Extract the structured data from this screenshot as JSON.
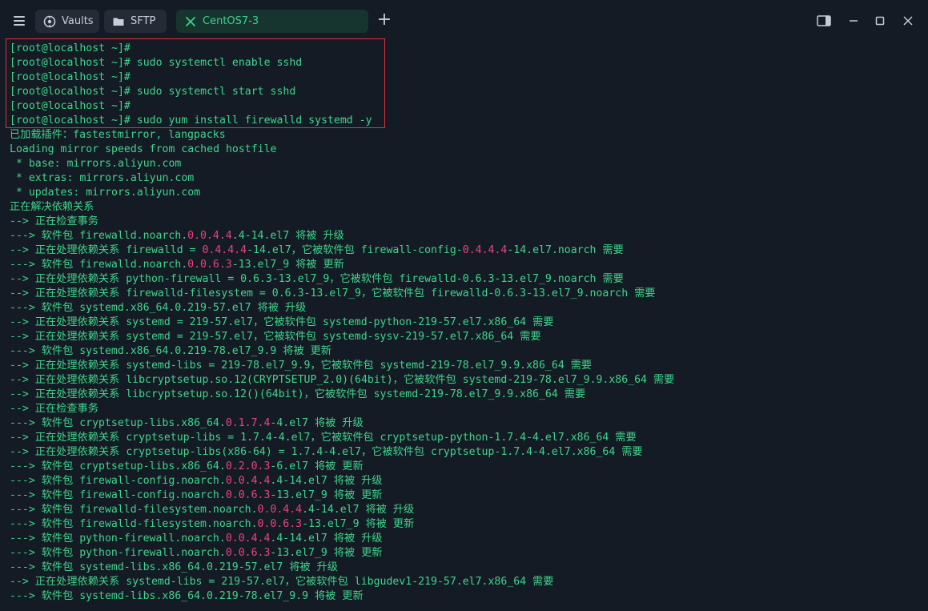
{
  "tabs": [
    {
      "label": "Vaults",
      "icon": "vault-icon"
    },
    {
      "label": "SFTP",
      "icon": "folder-icon"
    },
    {
      "label": "CentOS7-3",
      "icon": "close-icon",
      "active": true
    }
  ],
  "colors": {
    "accent": "#3fcf8e",
    "highlight_border": "#e0303e",
    "version_highlight": "#e8457f",
    "terminal_text": "#3ed58b"
  },
  "terminal": {
    "lines": [
      {
        "segments": [
          "[root@localhost ~]#"
        ]
      },
      {
        "segments": [
          "[root@localhost ~]# sudo systemctl enable sshd"
        ]
      },
      {
        "segments": [
          "[root@localhost ~]#"
        ]
      },
      {
        "segments": [
          "[root@localhost ~]# sudo systemctl start sshd"
        ]
      },
      {
        "segments": [
          "[root@localhost ~]#"
        ]
      },
      {
        "segments": [
          "[root@localhost ~]# sudo yum install firewalld systemd -y"
        ]
      },
      {
        "segments": [
          "已加载插件：fastestmirror, langpacks"
        ]
      },
      {
        "segments": [
          "Loading mirror speeds from cached hostfile"
        ]
      },
      {
        "segments": [
          " * base: mirrors.aliyun.com"
        ]
      },
      {
        "segments": [
          " * extras: mirrors.aliyun.com"
        ]
      },
      {
        "segments": [
          " * updates: mirrors.aliyun.com"
        ]
      },
      {
        "segments": [
          "正在解决依赖关系"
        ]
      },
      {
        "segments": [
          "--> 正在检查事务"
        ]
      },
      {
        "segments": [
          "---> 软件包 firewalld.noarch.",
          "0.0.4.4",
          ".4-14.el7 将被 升级"
        ]
      },
      {
        "segments": [
          "--> 正在处理依赖关系 firewalld = ",
          "0.4.4.4",
          "-14.el7，它被软件包 firewall-config-",
          "0.4.4.4",
          "-14.el7.noarch 需要"
        ]
      },
      {
        "segments": [
          "---> 软件包 firewalld.noarch.",
          "0.0.6.3",
          "-13.el7_9 将被 更新"
        ]
      },
      {
        "segments": [
          "--> 正在处理依赖关系 python-firewall = 0.6.3-13.el7_9，它被软件包 firewalld-0.6.3-13.el7_9.noarch 需要"
        ]
      },
      {
        "segments": [
          "--> 正在处理依赖关系 firewalld-filesystem = 0.6.3-13.el7_9，它被软件包 firewalld-0.6.3-13.el7_9.noarch 需要"
        ]
      },
      {
        "segments": [
          "---> 软件包 systemd.x86_64.0.219-57.el7 将被 升级"
        ]
      },
      {
        "segments": [
          "--> 正在处理依赖关系 systemd = 219-57.el7，它被软件包 systemd-python-219-57.el7.x86_64 需要"
        ]
      },
      {
        "segments": [
          "--> 正在处理依赖关系 systemd = 219-57.el7，它被软件包 systemd-sysv-219-57.el7.x86_64 需要"
        ]
      },
      {
        "segments": [
          "---> 软件包 systemd.x86_64.0.219-78.el7_9.9 将被 更新"
        ]
      },
      {
        "segments": [
          "--> 正在处理依赖关系 systemd-libs = 219-78.el7_9.9，它被软件包 systemd-219-78.el7_9.9.x86_64 需要"
        ]
      },
      {
        "segments": [
          "--> 正在处理依赖关系 libcryptsetup.so.12(CRYPTSETUP_2.0)(64bit)，它被软件包 systemd-219-78.el7_9.9.x86_64 需要"
        ]
      },
      {
        "segments": [
          "--> 正在处理依赖关系 libcryptsetup.so.12()(64bit)，它被软件包 systemd-219-78.el7_9.9.x86_64 需要"
        ]
      },
      {
        "segments": [
          "--> 正在检查事务"
        ]
      },
      {
        "segments": [
          "---> 软件包 cryptsetup-libs.x86_64.",
          "0.1.7.4",
          "-4.el7 将被 升级"
        ]
      },
      {
        "segments": [
          "--> 正在处理依赖关系 cryptsetup-libs = 1.7.4-4.el7，它被软件包 cryptsetup-python-1.7.4-4.el7.x86_64 需要"
        ]
      },
      {
        "segments": [
          "--> 正在处理依赖关系 cryptsetup-libs(x86-64) = 1.7.4-4.el7，它被软件包 cryptsetup-1.7.4-4.el7.x86_64 需要"
        ]
      },
      {
        "segments": [
          "---> 软件包 cryptsetup-libs.x86_64.",
          "0.2.0.3",
          "-6.el7 将被 更新"
        ]
      },
      {
        "segments": [
          "---> 软件包 firewall-config.noarch.",
          "0.0.4.4",
          ".4-14.el7 将被 升级"
        ]
      },
      {
        "segments": [
          "---> 软件包 firewall-config.noarch.",
          "0.0.6.3",
          "-13.el7_9 将被 更新"
        ]
      },
      {
        "segments": [
          "---> 软件包 firewalld-filesystem.noarch.",
          "0.0.4.4",
          ".4-14.el7 将被 升级"
        ]
      },
      {
        "segments": [
          "---> 软件包 firewalld-filesystem.noarch.",
          "0.0.6.3",
          "-13.el7_9 将被 更新"
        ]
      },
      {
        "segments": [
          "---> 软件包 python-firewall.noarch.",
          "0.0.4.4",
          ".4-14.el7 将被 升级"
        ]
      },
      {
        "segments": [
          "---> 软件包 python-firewall.noarch.",
          "0.0.6.3",
          "-13.el7_9 将被 更新"
        ]
      },
      {
        "segments": [
          "---> 软件包 systemd-libs.x86_64.0.219-57.el7 将被 升级"
        ]
      },
      {
        "segments": [
          "--> 正在处理依赖关系 systemd-libs = 219-57.el7，它被软件包 libgudev1-219-57.el7.x86_64 需要"
        ]
      },
      {
        "segments": [
          "---> 软件包 systemd-libs.x86_64.0.219-78.el7_9.9 将被 更新"
        ]
      }
    ]
  }
}
